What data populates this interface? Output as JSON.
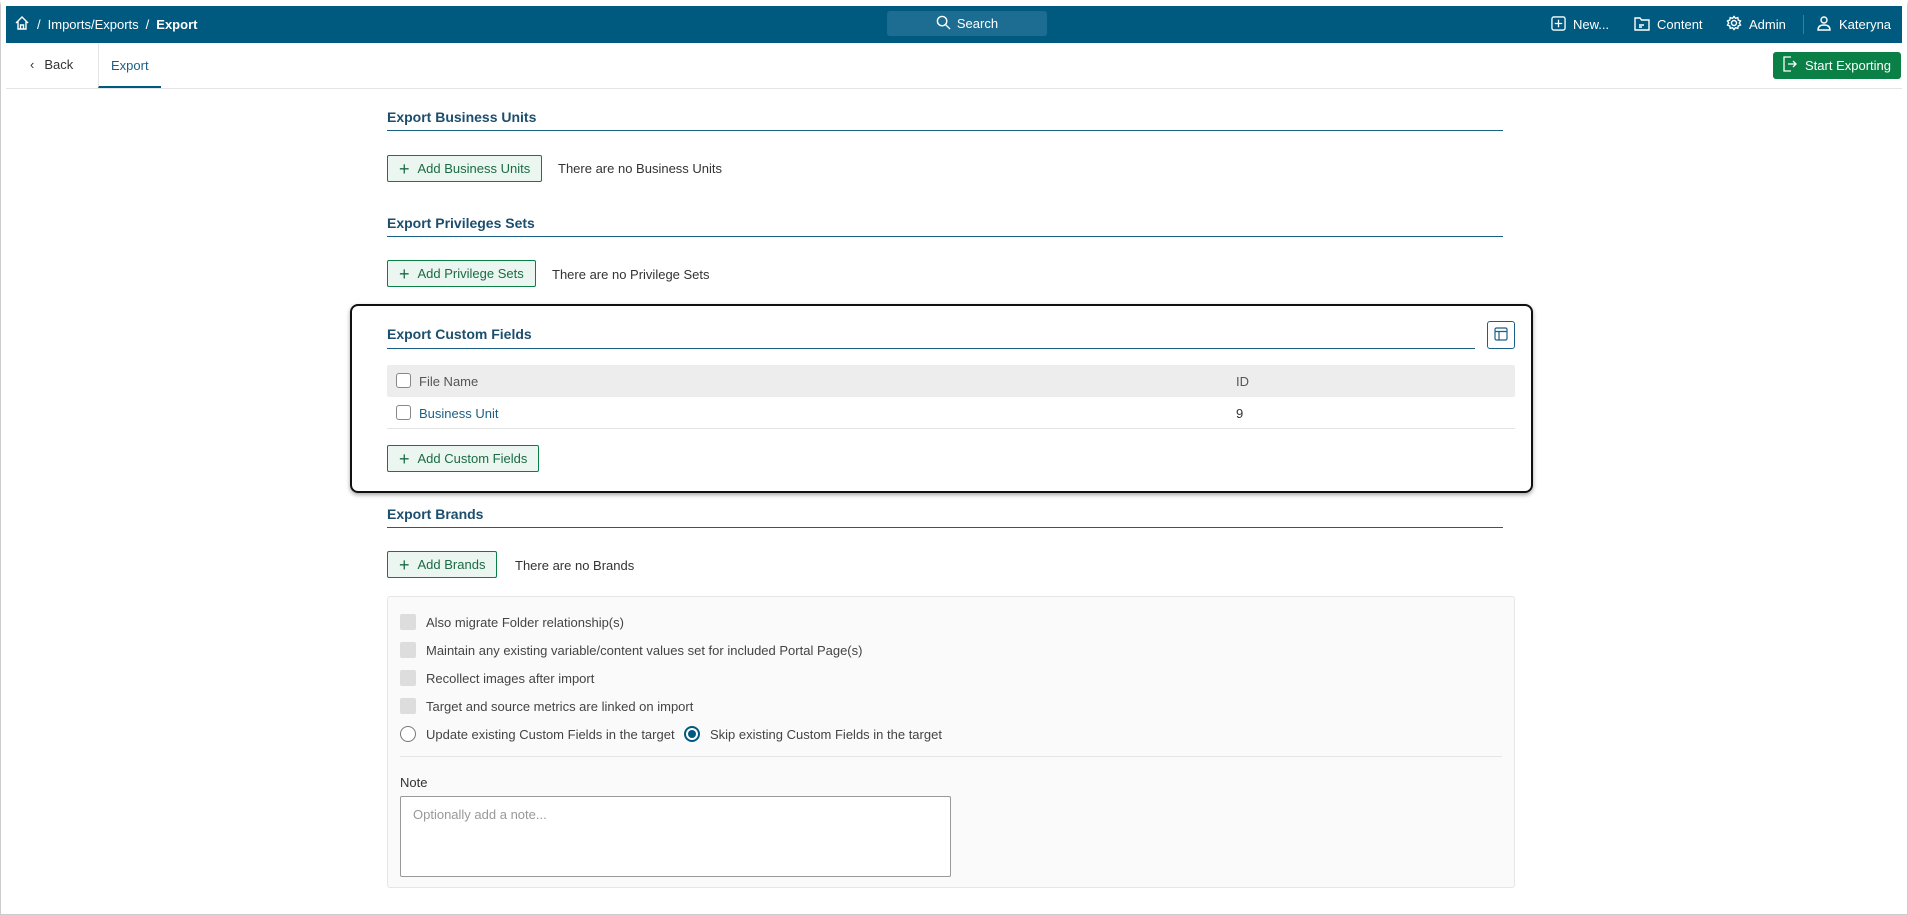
{
  "topbar": {
    "breadcrumb": [
      "Imports/Exports",
      "Export"
    ],
    "search_label": "Search",
    "new_label": "New...",
    "content_label": "Content",
    "admin_label": "Admin",
    "user_label": "Kateryna"
  },
  "subnav": {
    "back_label": "Back",
    "tab_label": "Export",
    "start_label": "Start Exporting"
  },
  "business_units": {
    "title": "Export Business Units",
    "add_label": "Add Business Units",
    "empty": "There are no Business Units"
  },
  "privileges": {
    "title": "Export Privileges Sets",
    "add_label": "Add Privilege Sets",
    "empty": "There are no Privilege Sets"
  },
  "custom_fields": {
    "title": "Export Custom Fields",
    "columns": [
      "File Name",
      "ID"
    ],
    "rows": [
      {
        "name": "Business Unit",
        "id": "9"
      }
    ],
    "add_label": "Add Custom Fields"
  },
  "brands": {
    "title": "Export Brands",
    "add_label": "Add Brands",
    "empty": "There are no Brands"
  },
  "options": {
    "checkboxes": [
      "Also migrate Folder relationship(s)",
      "Maintain any existing variable/content values set for included Portal Page(s)",
      "Recollect images after import",
      "Target and source metrics are linked on import"
    ],
    "radios": [
      {
        "label": "Update existing Custom Fields in the target",
        "selected": false
      },
      {
        "label": "Skip existing Custom Fields in the target",
        "selected": true
      }
    ],
    "note_label": "Note",
    "note_placeholder": "Optionally add a note..."
  },
  "colors": {
    "brand": "#005a7f",
    "accent_green": "#0a7f46"
  }
}
